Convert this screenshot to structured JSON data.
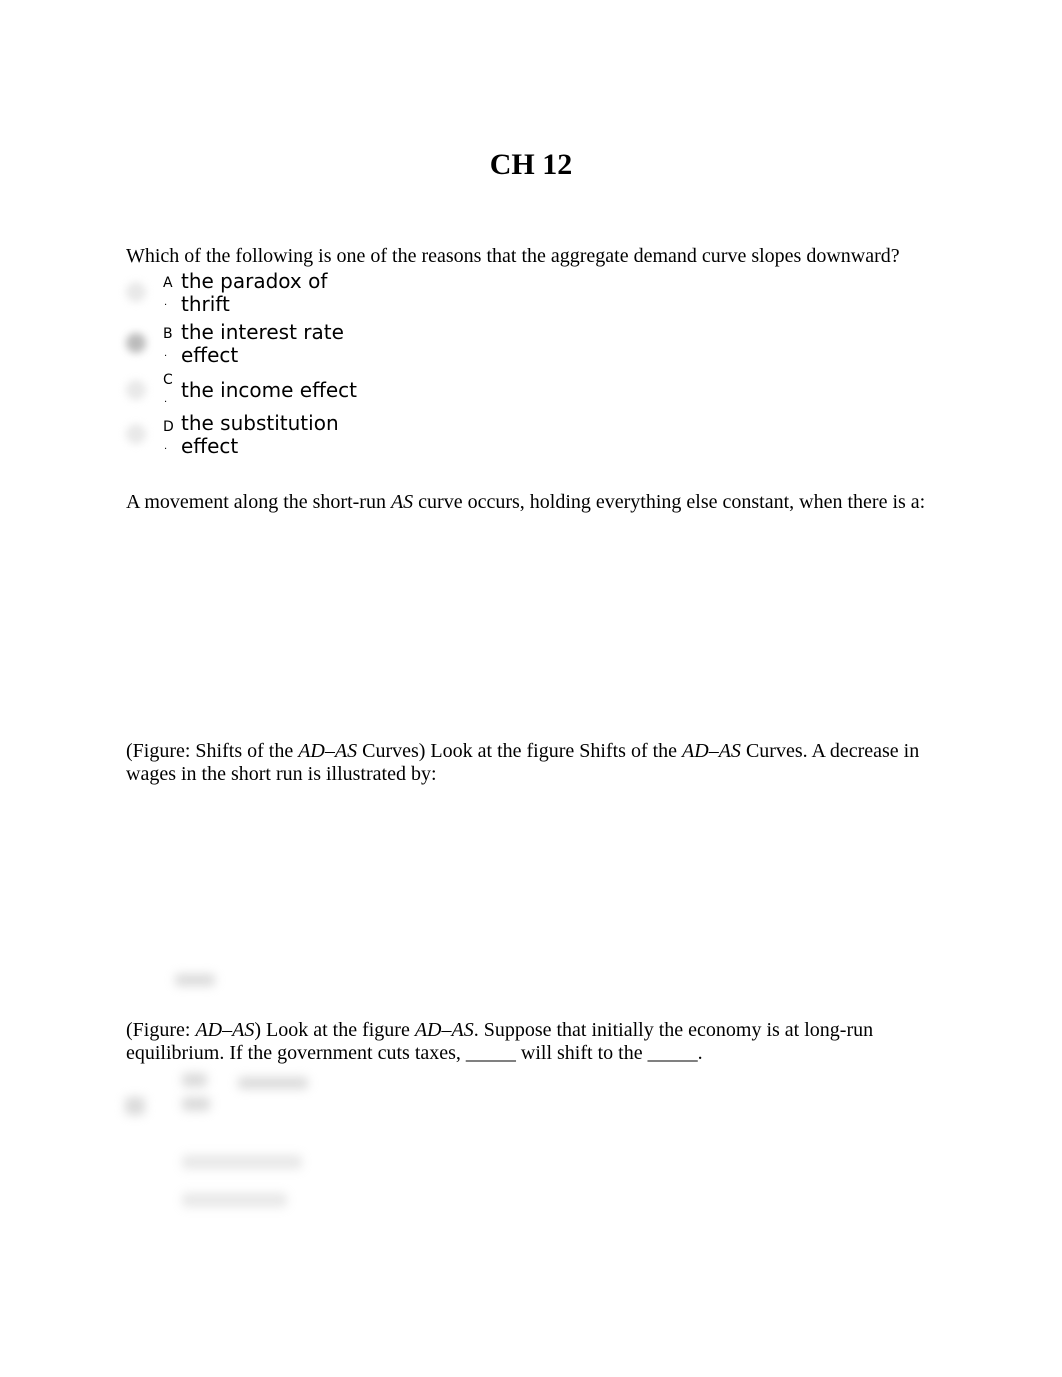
{
  "document": {
    "title": "CH 12",
    "questions": [
      {
        "text": "Which of the following is one of the reasons that the aggregate demand curve slopes downward?",
        "options": [
          {
            "letter": "A",
            "line1": "the paradox of",
            "line2": "thrift"
          },
          {
            "letter": "B",
            "line1": "the interest rate",
            "line2": "effect"
          },
          {
            "letter": "C",
            "line1": "the income effect",
            "line2": ""
          },
          {
            "letter": "D",
            "line1": "the substitution",
            "line2": "effect"
          }
        ]
      },
      {
        "text_pre": "A movement along the short-run ",
        "text_em": "AS",
        "text_post": " curve occurs, holding everything else constant, when there is a:"
      },
      {
        "p1": "(Figure: Shifts of the ",
        "em1": "AD–AS",
        "p2": " Curves) Look at the figure Shifts of the ",
        "em2": "AD–AS",
        "p3": " Curves. A decrease in wages in the short run is illustrated by:"
      },
      {
        "p1": "(Figure: ",
        "em1": "AD–AS",
        "p2": ") Look at the figure ",
        "em2": "AD–AS",
        "p3": ". Suppose that initially the economy is at long-run equilibrium. If the government cuts taxes, _____ will shift to the _____."
      }
    ],
    "dot": "·"
  }
}
